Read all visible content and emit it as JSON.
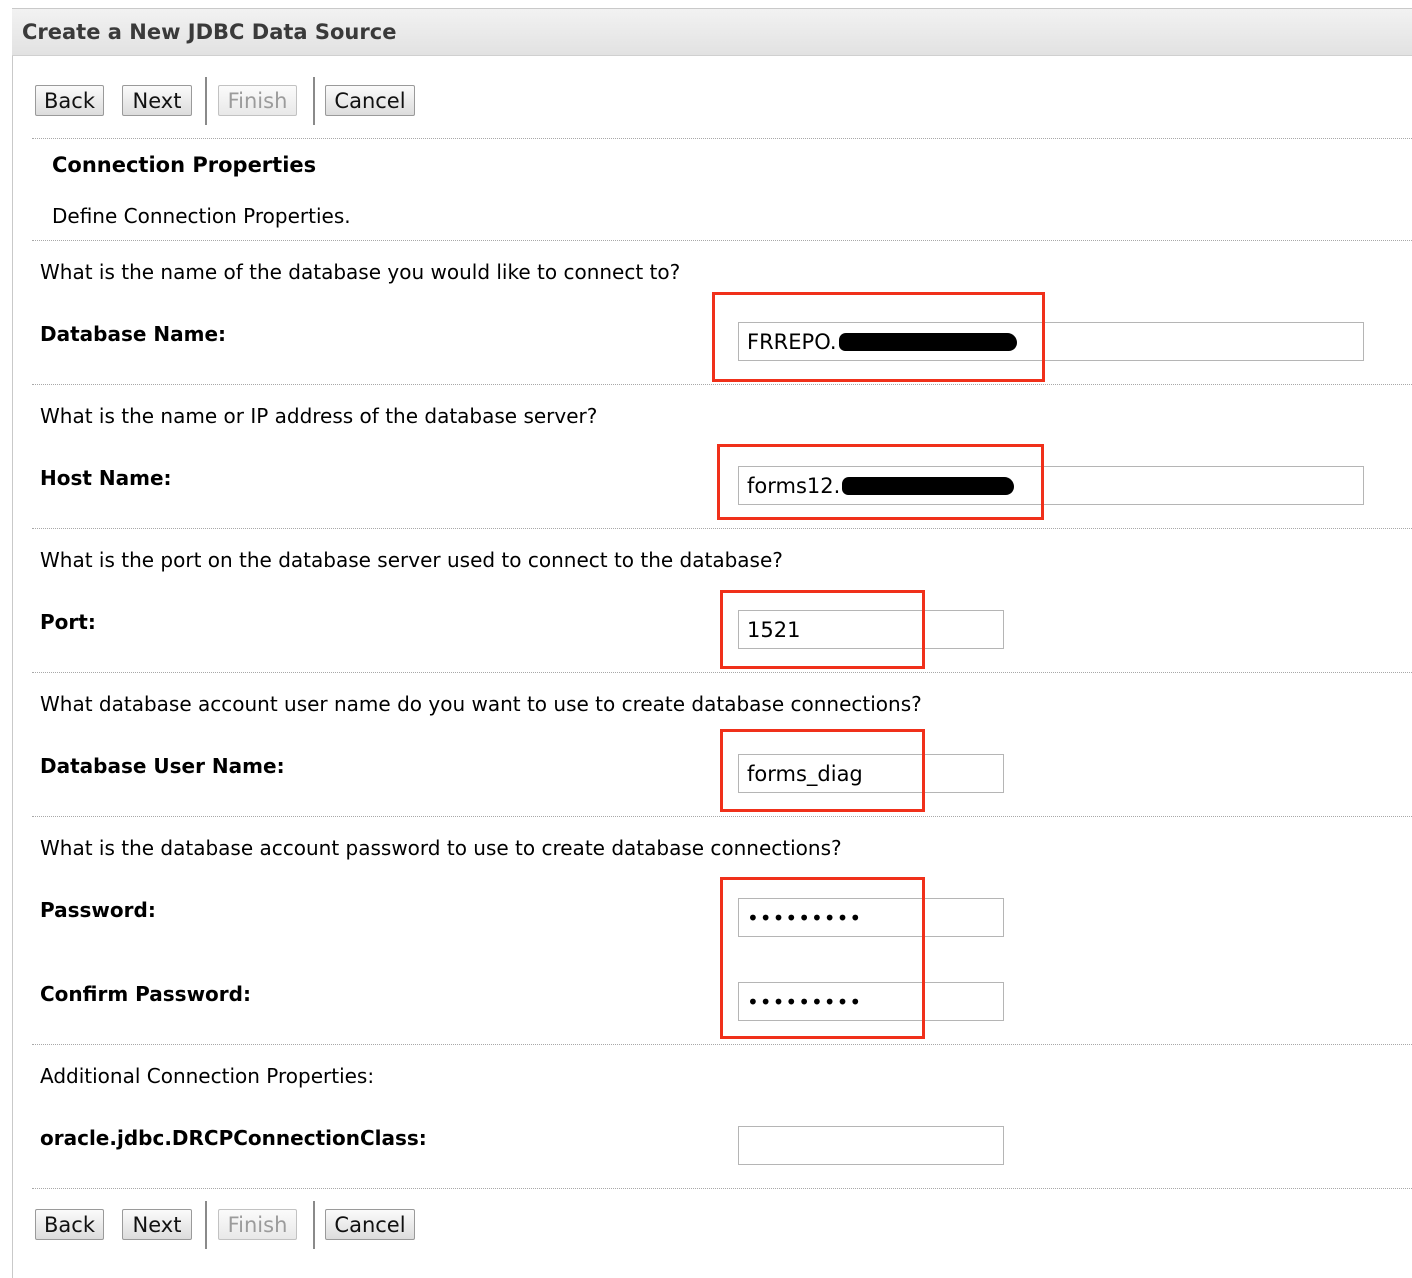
{
  "header": {
    "title": "Create a New JDBC Data Source"
  },
  "buttons": {
    "back": "Back",
    "next": "Next",
    "finish": "Finish",
    "cancel": "Cancel"
  },
  "section": {
    "title": "Connection Properties",
    "description": "Define Connection Properties."
  },
  "form": {
    "database_name": {
      "question": "What is the name of the database you would like to connect to?",
      "label": "Database Name:",
      "value": "FRREPO."
    },
    "host_name": {
      "question": "What is the name or IP address of the database server?",
      "label": "Host Name:",
      "value": "forms12."
    },
    "port": {
      "question": "What is the port on the database server used to connect to the database?",
      "label": "Port:",
      "value": "1521"
    },
    "user_name": {
      "question": "What database account user name do you want to use to create database connections?",
      "label": "Database User Name:",
      "value": "forms_diag"
    },
    "password": {
      "question": "What is the database account password to use to create database connections?",
      "label": "Password:",
      "value": "•••••••••"
    },
    "confirm_password": {
      "label": "Confirm Password:",
      "value": "•••••••••"
    },
    "additional": {
      "heading": "Additional Connection Properties:",
      "label": "oracle.jdbc.DRCPConnectionClass:",
      "value": ""
    }
  },
  "colors": {
    "highlight": "#f0301a",
    "title_bar": "#e8e8e8",
    "disabled_text": "#9b9b9b"
  }
}
